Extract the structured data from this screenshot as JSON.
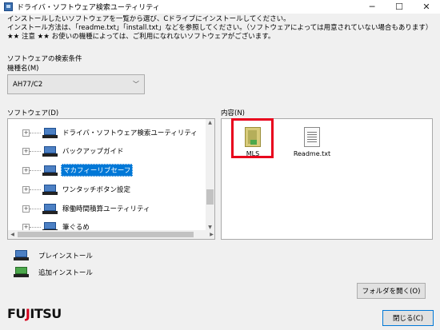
{
  "window": {
    "title": "ドライバ・ソフトウェア検索ユーティリティ",
    "minimize": "─",
    "maximize": "☐",
    "close": "✕"
  },
  "instructions": {
    "line1": "インストールしたいソフトウェアを一覧から選び、Cドライブにインストールしてください。",
    "line2": "インストール方法は、「readme.txt」「install.txt」などを参照してください。（ソフトウェアによっては用意されていない場合もあります）",
    "line3": "★★ 注意 ★★ お使いの機種によっては、ご利用になれないソフトウェアがございます。"
  },
  "search": {
    "section_label": "ソフトウェアの検索条件",
    "model_label": "機種名(M)",
    "model_value": "AH77/C2"
  },
  "software": {
    "label": "ソフトウェア(D)",
    "items": [
      {
        "label": "ドライバ・ソフトウェア検索ユーティリティ"
      },
      {
        "label": "バックアップガイド"
      },
      {
        "label": "マカフィーリブセーフ"
      },
      {
        "label": "ワンタッチボタン設定"
      },
      {
        "label": "稼働時間積算ユーティリティ"
      },
      {
        "label": "筆ぐるめ"
      }
    ],
    "selected_index": 2
  },
  "contents": {
    "label": "内容(N)",
    "files": [
      {
        "name": "MLS",
        "icon": "folder-icon"
      },
      {
        "name": "Readme.txt",
        "icon": "text-file-icon"
      }
    ]
  },
  "legend": {
    "preinstall": "プレインストール",
    "additional": "追加インストール"
  },
  "buttons": {
    "open_folder": "フォルダを開く(O)",
    "close": "閉じる(C)"
  },
  "logo": {
    "text_pre": "FU",
    "text_accent": "J",
    "text_post": "ITSU"
  },
  "colors": {
    "selection": "#0078d7",
    "highlight_box": "#e8001c",
    "logo_accent": "#d4001a"
  }
}
